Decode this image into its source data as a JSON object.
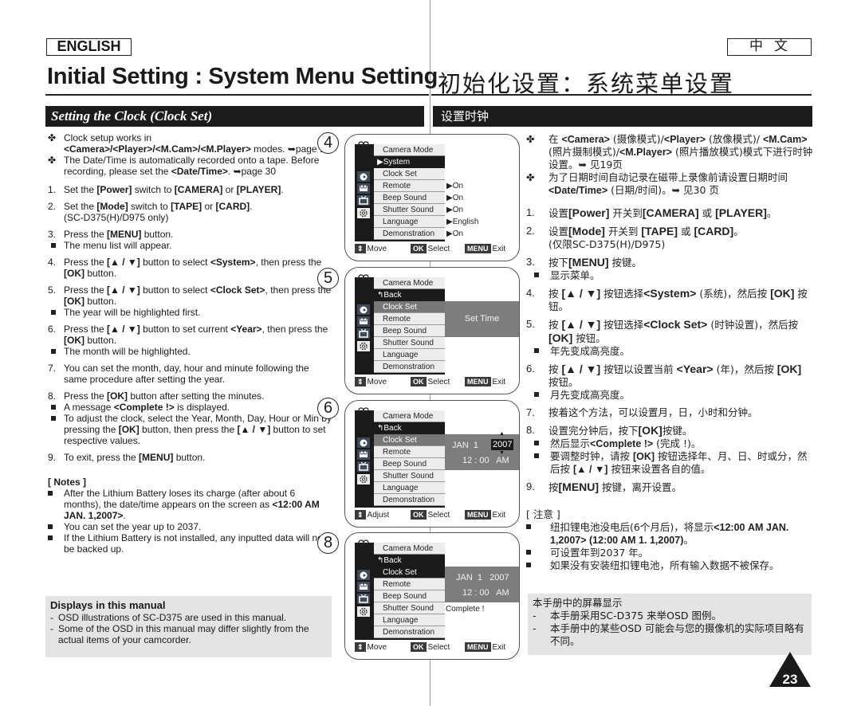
{
  "header": {
    "lang_en": "ENGLISH",
    "lang_zh": "中文",
    "title_en": "Initial Setting : System Menu Setting",
    "title_zh": "初始化设置：系统菜单设置",
    "section_en": "Setting the Clock (Clock Set)",
    "section_zh": "设置时钟"
  },
  "english": {
    "intro": [
      {
        "pre": "Clock setup works in ",
        "bold": "<Camera>/<Player>/<M.Cam>/<M.Player>",
        "post": " modes. ➥page 19"
      },
      {
        "pre": "The Date/Time is automatically recorded onto a tape. Before recording, please set the ",
        "bold": "<Date/Time>",
        "post": ". ➥page 30"
      }
    ],
    "steps": [
      {
        "num": "1.",
        "html": "Set the <b>[Power]</b> switch to <b>[CAMERA]</b> or <b>[PLAYER]</b>.",
        "subs": []
      },
      {
        "num": "2.",
        "html": "Set the <b>[Mode]</b> switch to <b>[TAPE]</b> or <b>[CARD]</b>.<br>(SC-D375(H)/D975 only)",
        "subs": []
      },
      {
        "num": "3.",
        "html": "Press the <b>[MENU]</b> button.",
        "subs": [
          "The menu list will appear."
        ]
      },
      {
        "num": "4.",
        "html": "Press the <b>[▲ / ▼]</b> button to select <b>&lt;System&gt;</b>, then press the <b>[OK]</b> button.",
        "subs": []
      },
      {
        "num": "5.",
        "html": "Press the <b>[▲ / ▼]</b> button to select <b>&lt;Clock Set&gt;</b>, then press the <b>[OK]</b> button.",
        "subs": [
          "The year will be highlighted first."
        ]
      },
      {
        "num": "6.",
        "html": "Press the <b>[▲ / ▼]</b> button to set current <b>&lt;Year&gt;</b>, then press the <b>[OK]</b> button.",
        "subs": [
          "The month will be highlighted."
        ]
      },
      {
        "num": "7.",
        "html": "You can set the month, day, hour and minute following the same procedure after setting the year.",
        "subs": []
      },
      {
        "num": "8.",
        "html": "Press the <b>[OK]</b> button after setting the minutes.",
        "subs": [
          "A message <b>&lt;Complete !&gt;</b> is displayed.",
          "To adjust the clock, select the Year, Month, Day, Hour or Min by pressing the <b>[OK]</b> button, then press the <b>[▲ / ▼]</b> button to set respective values."
        ]
      },
      {
        "num": "9.",
        "html": "To exit, press the <b>[MENU]</b> button.",
        "subs": []
      }
    ],
    "notes_title": "[ Notes ]",
    "notes": [
      "After the Lithium Battery loses its charge (after about 6 months), the date/time appears on the screen as <b>&lt;12:00 AM JAN. 1,2007&gt;</b>.",
      "You can set the year up to 2037.",
      "If the Lithium Battery is not installed, any inputted data will not be backed up."
    ],
    "displays_title": "Displays in this manual",
    "displays_items": [
      "OSD illustrations of SC-D375 are used in this manual.",
      "Some of the OSD in this manual may differ slightly from the actual items of your camcorder."
    ]
  },
  "callouts": [
    "4",
    "5",
    "6",
    "8"
  ],
  "osd": {
    "mode": "Camera Mode",
    "items": [
      "Clock Set",
      "Remote",
      "Beep Sound",
      "Shutter Sound",
      "Language",
      "Demonstration"
    ],
    "screens": [
      {
        "nav": "▶System",
        "values": [
          "▶On",
          "▶On",
          "▶On",
          "▶English",
          "▶On"
        ],
        "footer": {
          "move": "Move",
          "ok": "OK",
          "select": "Select",
          "menu": "MENU",
          "exit": "Exit"
        }
      },
      {
        "nav": "↰Back",
        "panel_text": "Set Time",
        "footer": {
          "move": "Move",
          "ok": "OK",
          "select": "Select",
          "menu": "MENU",
          "exit": "Exit"
        }
      },
      {
        "nav": "↰Back",
        "date": "JAN  1",
        "year": "2007",
        "time": "12 : 00   AM",
        "footer": {
          "move": "Adjust",
          "ok": "OK",
          "select": "Select",
          "menu": "MENU",
          "exit": "Exit"
        }
      },
      {
        "nav": "↰Back",
        "date": "JAN  1   2007",
        "time": "12 : 00   AM",
        "complete": "Complete !",
        "footer": {
          "move": "Move",
          "ok": "OK",
          "select": "Select",
          "menu": "MENU",
          "exit": "Exit"
        }
      }
    ]
  },
  "chinese": {
    "intro": [
      "在 <b>&lt;Camera&gt;</b> (摄像模式)/<b>&lt;Player&gt;</b> (放像模式)/ <b>&lt;M.Cam&gt;</b> (照片摄制模式)/<b>&lt;M.Player&gt;</b> (照片播放模式)模式下进行时钟设置。➥ 见19页",
      "为了日期时间自动记录在磁带上录像前请设置日期时间 <b>&lt;Date/Time&gt;</b> (日期/时间)。➥ 见30 页"
    ],
    "steps": [
      {
        "num": "1.",
        "html": "设置<b>[Power]</b> 开关到<b>[CAMERA]</b> 或 <b>[PLAYER]</b>。",
        "subs": []
      },
      {
        "num": "2.",
        "html": "设置<b>[Mode]</b> 开关到 <b>[TAPE]</b> 或 <b>[CARD]</b>。<br>(仅限SC-D375(H)/D975)",
        "subs": []
      },
      {
        "num": "3.",
        "html": "按下<b>[MENU]</b> 按键。",
        "subs": [
          "显示菜单。"
        ]
      },
      {
        "num": "4.",
        "html": "按 <b>[▲ / ▼]</b> 按钮选择<b>&lt;System&gt;</b> (系统)，然后按 <b>[OK]</b> 按钮。",
        "subs": []
      },
      {
        "num": "5.",
        "html": "按 <b>[▲ / ▼]</b> 按钮选择<b>&lt;Clock Set&gt;</b> (时钟设置)，然后按<b>[OK]</b> 按钮。",
        "subs": [
          "年先变成高亮度。"
        ]
      },
      {
        "num": "6.",
        "html": "按 <b>[▲ / ▼]</b> 按钮以设置当前 <b>&lt;Year&gt;</b> (年)，然后按 <b>[OK]</b> 按钮。",
        "subs": [
          "月先变成高亮度。"
        ]
      },
      {
        "num": "7.",
        "html": "按着这个方法，可以设置月，日，小时和分钟。",
        "subs": []
      },
      {
        "num": "8.",
        "html": "设置完分钟后，按下<b>[OK]</b>按键。",
        "subs": [
          "然后显示<b>&lt;Complete !&gt;</b> (完成 !)。",
          "要调整时钟，请按 <b>[OK]</b> 按钮选择年、月、日、时或分，然后按 <b>[▲ / ▼]</b> 按钮来设置各自的值。"
        ]
      },
      {
        "num": "9.",
        "html": "按<b>[MENU]</b> 按键，离开设置。",
        "subs": []
      }
    ],
    "notes_title": "[ 注意 ]",
    "notes": [
      "纽扣锂电池没电后(6个月后)，将显示<b>&lt;12:00 AM JAN. 1,2007&gt; (12:00 AM  1. 1,2007)</b>。",
      "可设置年到2037 年。",
      "如果没有安装纽扣锂电池，所有输入数据不被保存。"
    ],
    "displays_title": "本手册中的屏幕显示",
    "displays_items": [
      "本手册采用SC-D375 来举OSD 图例。",
      "本手册中的某些OSD 可能会与您的摄像机的实际项目略有不同。"
    ]
  },
  "page_number": "23"
}
